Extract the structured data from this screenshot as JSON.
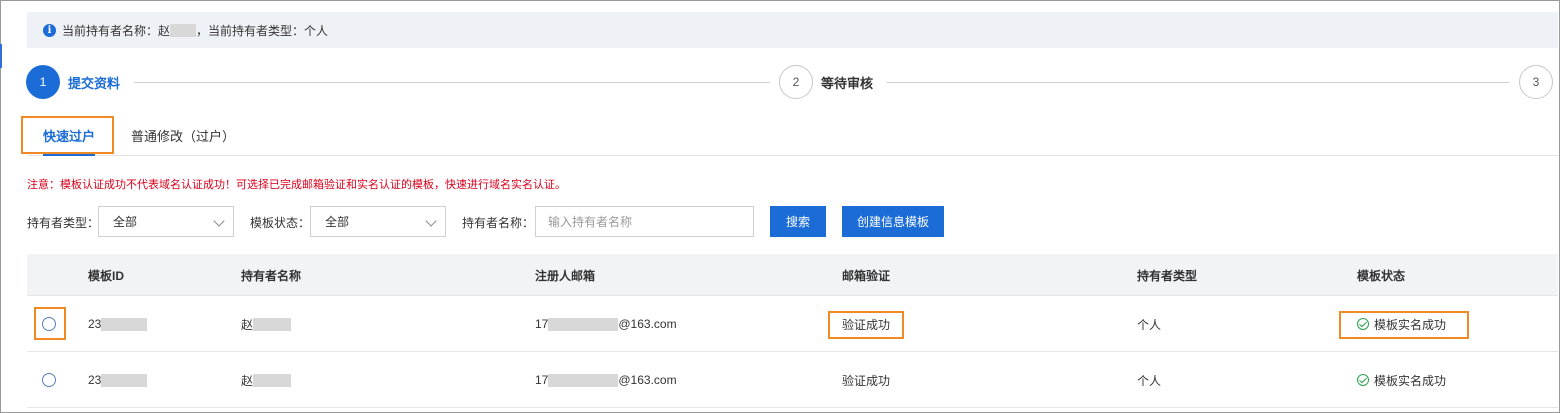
{
  "notice": {
    "holder_name_label": "当前持有者名称：",
    "holder_name_visible": "赵",
    "holder_type_label": "，当前持有者类型：",
    "holder_type_value": "个人"
  },
  "steps": [
    {
      "number": "1",
      "label": "提交资料",
      "active": true
    },
    {
      "number": "2",
      "label": "等待审核",
      "active": false
    },
    {
      "number": "3",
      "label": "",
      "active": false
    }
  ],
  "tabs": [
    {
      "label": "快速过户",
      "active": true
    },
    {
      "label": "普通修改（过户）",
      "active": false
    }
  ],
  "warning": "注意：模板认证成功不代表域名认证成功！可选择已完成邮箱验证和实名认证的模板，快速进行域名实名认证。",
  "filters": {
    "holder_type_label": "持有者类型：",
    "holder_type_value": "全部",
    "template_status_label": "模板状态：",
    "template_status_value": "全部",
    "holder_name_label": "持有者名称：",
    "holder_name_placeholder": "输入持有者名称",
    "search_button": "搜索",
    "create_button": "创建信息模板"
  },
  "table": {
    "columns": [
      "模板ID",
      "持有者名称",
      "注册人邮箱",
      "邮箱验证",
      "持有者类型",
      "模板状态"
    ],
    "rows": [
      {
        "id_prefix": "23",
        "name_prefix": "赵",
        "email_prefix": "17",
        "email_suffix": "@163.com",
        "email_verify": "验证成功",
        "holder_type": "个人",
        "status": "模板实名成功"
      },
      {
        "id_prefix": "23",
        "name_prefix": "赵",
        "email_prefix": "17",
        "email_suffix": "@163.com",
        "email_verify": "验证成功",
        "holder_type": "个人",
        "status": "模板实名成功"
      }
    ]
  },
  "colors": {
    "primary": "#1b6cd6",
    "highlight": "#f08a24",
    "warning": "#d9001b",
    "success": "#2aa24a"
  }
}
